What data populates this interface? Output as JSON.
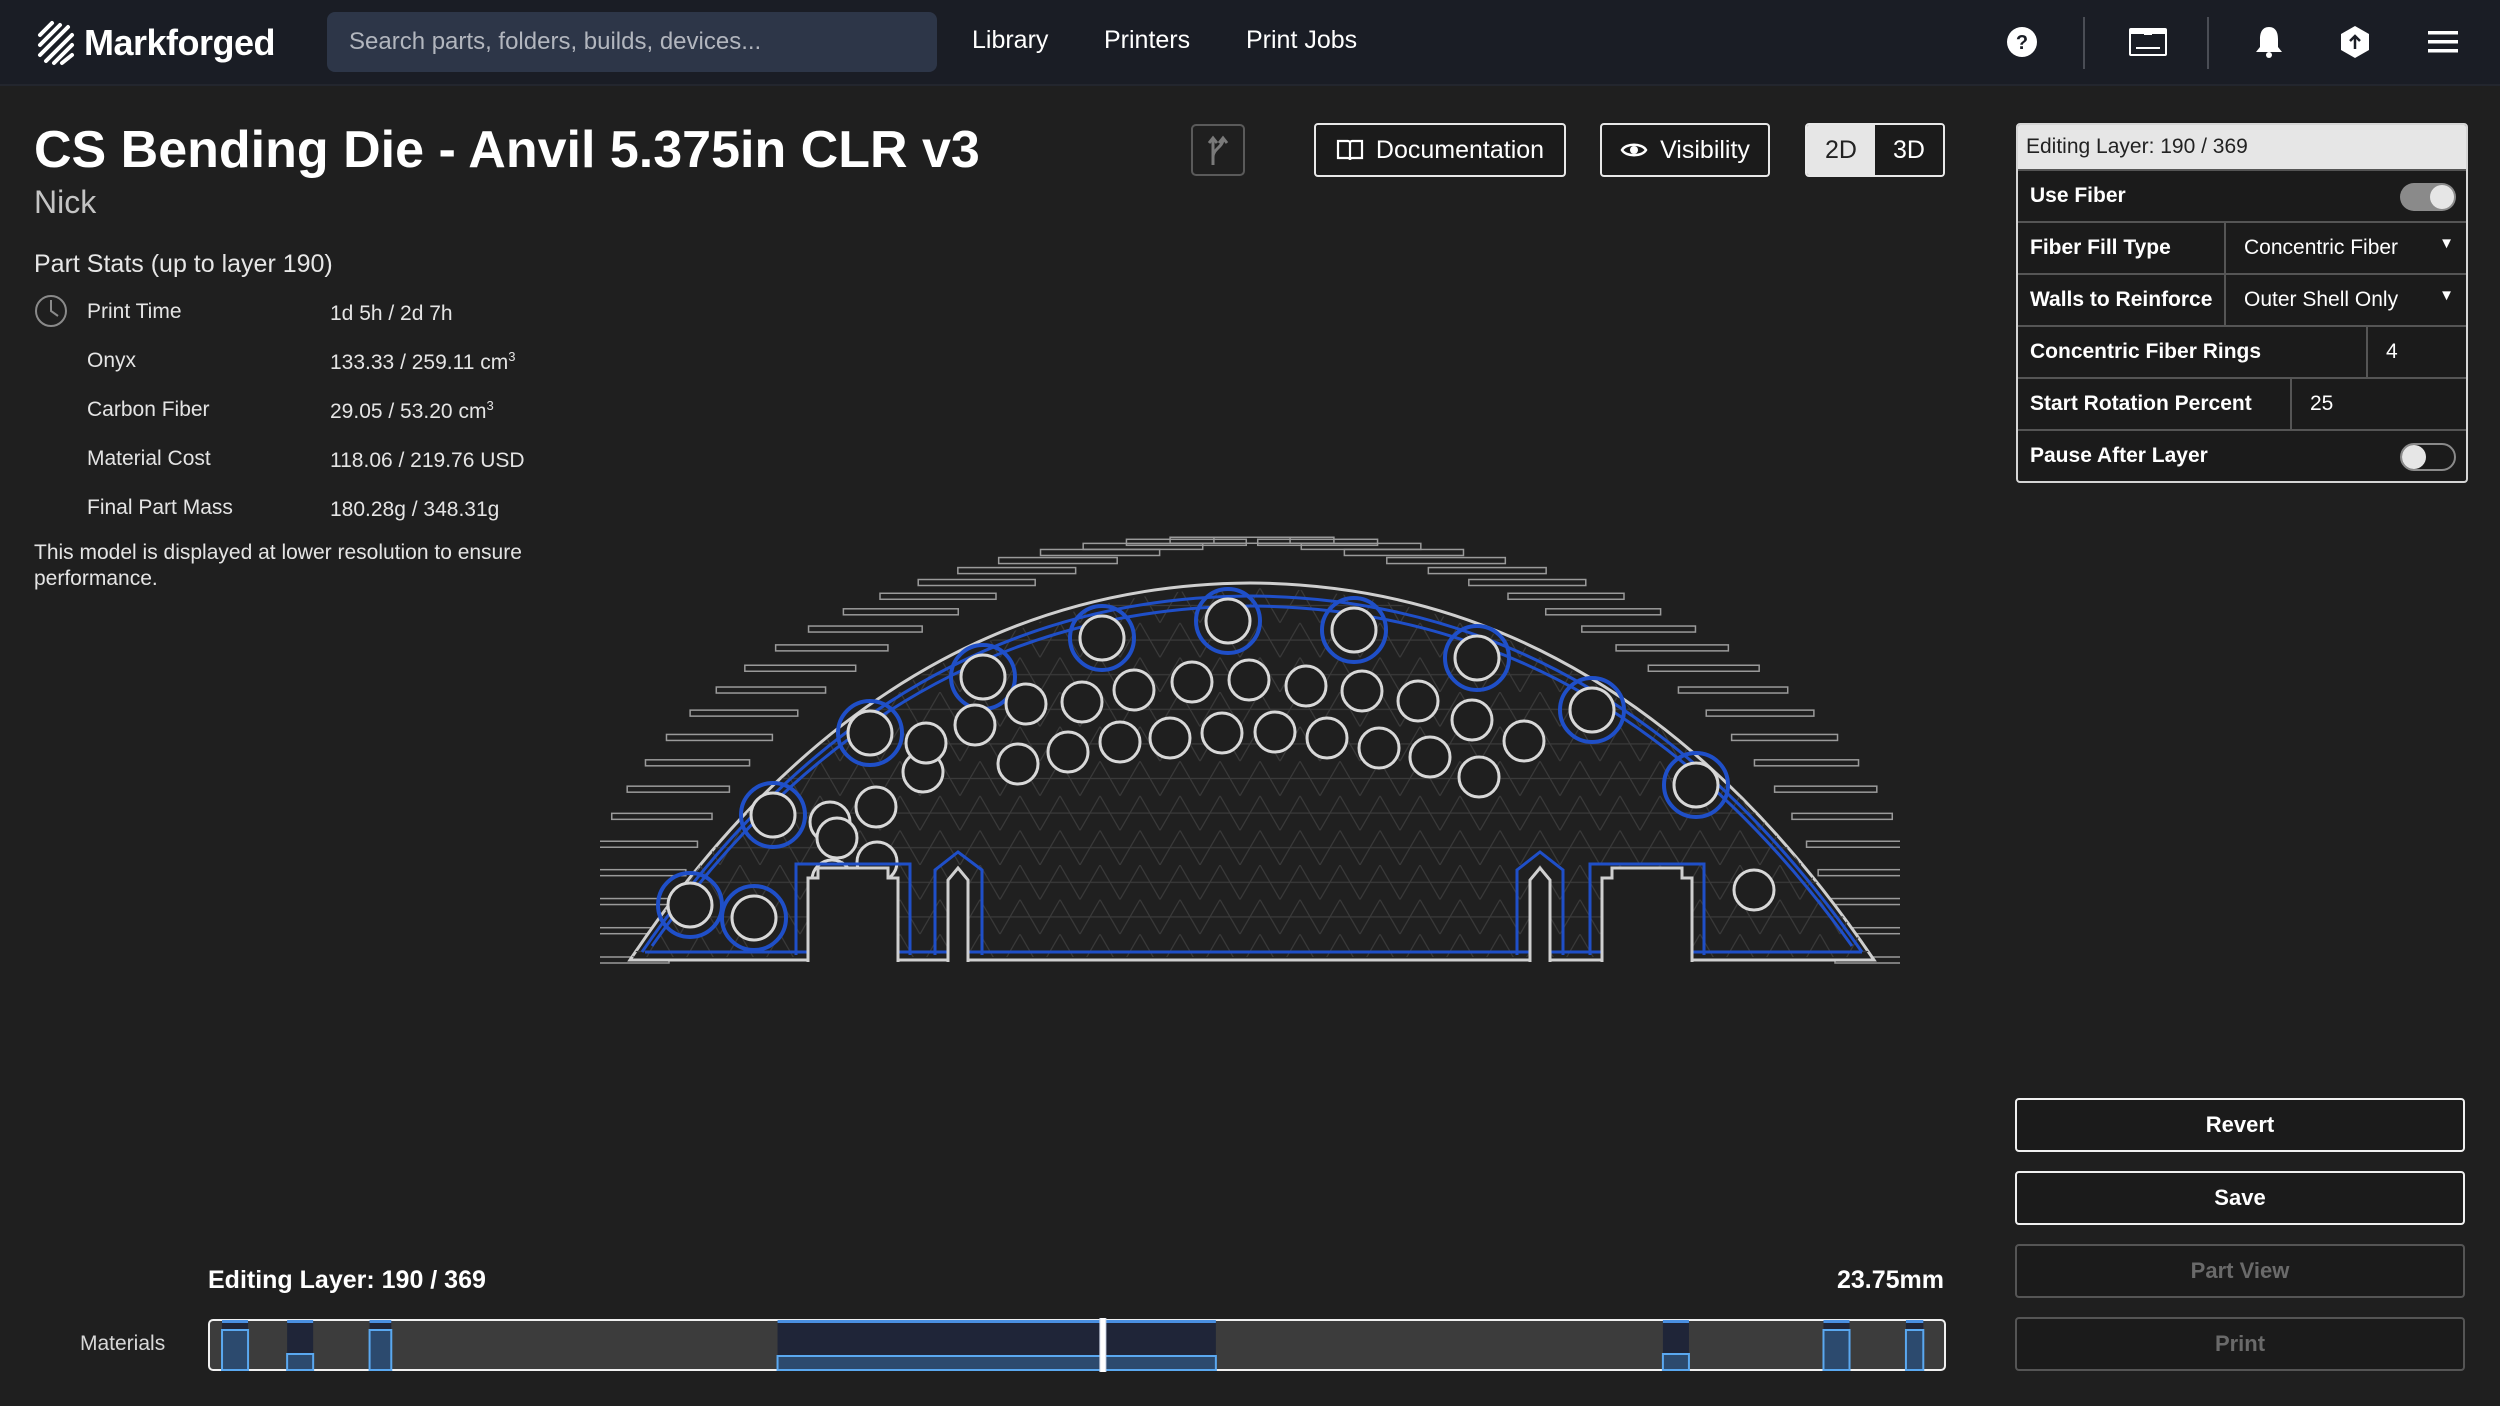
{
  "nav": {
    "logo_text": "Markforged",
    "search_placeholder": "Search parts, folders, builds, devices...",
    "links": [
      "Library",
      "Printers",
      "Print Jobs"
    ],
    "icons": [
      "help-icon",
      "printer-icon",
      "bell-icon",
      "upload-icon",
      "menu-icon"
    ]
  },
  "header": {
    "title": "CS Bending Die - Anvil 5.375in CLR v3",
    "owner": "Nick",
    "documentation_label": "Documentation",
    "visibility_label": "Visibility",
    "view_modes": [
      "2D",
      "3D"
    ],
    "active_view_mode": "2D"
  },
  "stats": {
    "title": "Part Stats (up to layer 190)",
    "rows": [
      {
        "label": "Print Time",
        "value": "1d 5h / 2d 7h",
        "unit_sup": ""
      },
      {
        "label": "Onyx",
        "value": "133.33 / 259.11 cm",
        "unit_sup": "3"
      },
      {
        "label": "Carbon Fiber",
        "value": "29.05 / 53.20 cm",
        "unit_sup": "3"
      },
      {
        "label": "Material Cost",
        "value": "118.06 / 219.76 USD",
        "unit_sup": ""
      },
      {
        "label": "Final Part Mass",
        "value": "180.28g / 348.31g",
        "unit_sup": ""
      }
    ],
    "note": "This model is displayed at lower resolution to ensure performance."
  },
  "layer_panel": {
    "header": "Editing Layer: 190 / 369",
    "use_fiber_label": "Use Fiber",
    "use_fiber": true,
    "fiber_fill_type_label": "Fiber Fill Type",
    "fiber_fill_type": "Concentric Fiber",
    "walls_label": "Walls to Reinforce",
    "walls_value": "Outer Shell Only",
    "rings_label": "Concentric Fiber Rings",
    "rings_value": "4",
    "rotation_label": "Start Rotation Percent",
    "rotation_value": "25",
    "pause_label": "Pause After Layer",
    "pause_after_layer": false
  },
  "actions": {
    "revert": "Revert",
    "save": "Save",
    "part_view": "Part View",
    "print": "Print"
  },
  "layer_slider": {
    "label": "Editing Layer: 190 / 369",
    "current_layer": 190,
    "total_layers": 369,
    "height_label": "23.75mm",
    "materials_label": "Materials",
    "fiber_layer_ranges": [
      [
        3,
        9
      ],
      [
        18,
        24
      ],
      [
        37,
        42
      ],
      [
        131,
        232
      ],
      [
        335,
        341
      ],
      [
        372,
        378
      ],
      [
        391,
        395
      ]
    ],
    "fiber_range_scale": 400
  },
  "colors": {
    "fiber_blue": "#1f4fc8",
    "slider_blue": "#4a90e2",
    "topbar": "#1a1d25",
    "background": "#1f1f1f"
  }
}
